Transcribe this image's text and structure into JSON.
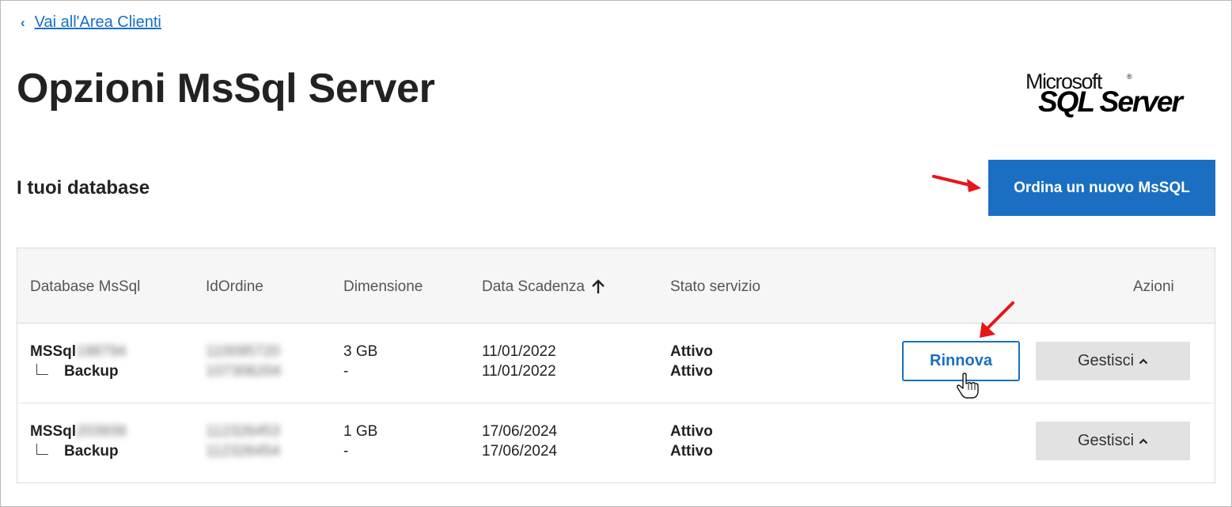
{
  "nav": {
    "back_label": "Vai all'Area Clienti"
  },
  "page": {
    "title": "Opzioni MsSql Server"
  },
  "logo": {
    "line1": "Microsoft",
    "line2": "SQL Server",
    "mark": "®"
  },
  "section": {
    "title": "I tuoi database",
    "new_button": "Ordina un nuovo MsSQL"
  },
  "table": {
    "headers": {
      "database": "Database MsSql",
      "id_ordine": "IdOrdine",
      "dimensione": "Dimensione",
      "scadenza": "Data Scadenza",
      "stato": "Stato servizio",
      "azioni": "Azioni"
    },
    "rows": [
      {
        "name_prefix": "MSSql",
        "name_suffix": "198794",
        "backup_label": "Backup",
        "id1": "110095720",
        "id2": "107306204",
        "size": "3 GB",
        "size_backup": "-",
        "date1": "11/01/2022",
        "date2": "11/01/2022",
        "status1": "Attivo",
        "status2": "Attivo",
        "renew_label": "Rinnova",
        "manage_label": "Gestisci"
      },
      {
        "name_prefix": "MSSql",
        "name_suffix": "203939",
        "backup_label": "Backup",
        "id1": "112326453",
        "id2": "112326454",
        "size": "1 GB",
        "size_backup": "-",
        "date1": "17/06/2024",
        "date2": "17/06/2024",
        "status1": "Attivo",
        "status2": "Attivo",
        "manage_label": "Gestisci"
      }
    ]
  },
  "icons": {
    "back": "chevron-left-icon",
    "sort": "arrow-up-icon",
    "manage": "chevron-up-icon",
    "cursor": "hand-pointer-icon",
    "annotation": "red-arrow-icon"
  },
  "colors": {
    "accent": "#1a6fc2",
    "annotation": "#e8151b",
    "manage_bg": "#e2e2e2"
  }
}
